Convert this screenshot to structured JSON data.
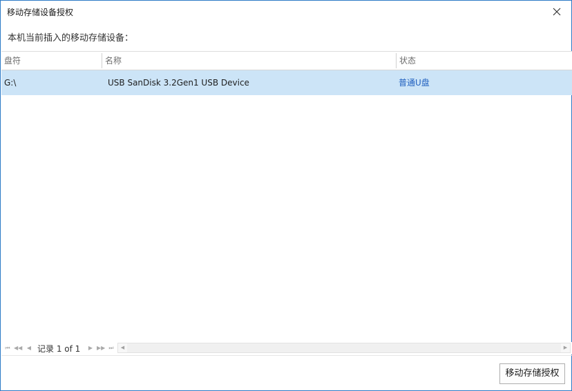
{
  "window": {
    "title": "移动存储设备授权",
    "subtitle": "本机当前插入的移动存储设备："
  },
  "table": {
    "columns": [
      "盘符",
      "名称",
      "状态"
    ],
    "rows": [
      {
        "drive": "G:\\",
        "name": "USB  SanDisk 3.2Gen1 USB Device",
        "status": "普通U盘"
      }
    ]
  },
  "pager": {
    "text": "记录 1 of 1"
  },
  "footer": {
    "authorize_label": "移动存储授权"
  },
  "colors": {
    "selection": "#cce4f7",
    "link": "#1f5fbf",
    "border": "#2b79c6"
  }
}
